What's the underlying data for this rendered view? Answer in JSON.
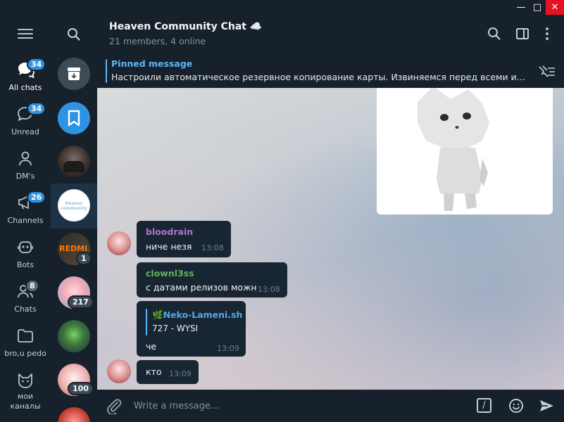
{
  "window": {
    "minimize_glyph": "—",
    "maximize_glyph": "□",
    "close_glyph": "✕"
  },
  "folders": [
    {
      "label": "All chats",
      "badge": "34",
      "icon": "chats-icon"
    },
    {
      "label": "Unread",
      "badge": "34",
      "icon": "chat-bubble-icon"
    },
    {
      "label": "DM's",
      "badge": "",
      "icon": "person-icon"
    },
    {
      "label": "Channels",
      "badge": "26",
      "icon": "channels-icon"
    },
    {
      "label": "Bots",
      "badge": "",
      "icon": "bot-icon"
    },
    {
      "label": "Chats",
      "badge": "8",
      "icon": "group-icon"
    },
    {
      "label": "bro,u pedo",
      "badge": "",
      "icon": "folder-icon"
    },
    {
      "label": "мои каналы",
      "badge": "",
      "icon": "cat-icon"
    }
  ],
  "chat_list": {
    "badges": [
      "1",
      "217",
      "100"
    ],
    "selected_avatar_text": "Heaven community"
  },
  "header": {
    "title": "Heaven Community Chat ☁️",
    "subtitle": "21 members, 4 online"
  },
  "pinned": {
    "title": "Pinned message",
    "text": "Настроили автоматическое резервное копирование карты. Извиняемся перед всеми игрок..."
  },
  "messages": [
    {
      "author": "bloodrain",
      "text": "ниче незя",
      "time": "13:08",
      "author_color": "#b273cc"
    },
    {
      "author": "clownl3ss",
      "text": "с датами релизов можн",
      "time": "13:08",
      "author_color": "#63b35d"
    },
    {
      "reply_name": "🌿Neko-Lameni.sh",
      "reply_text": "727 - WYSI",
      "text": "че",
      "time": "13:09"
    },
    {
      "text": "кто",
      "time": "13:09"
    }
  ],
  "composer": {
    "placeholder": "Write a message...",
    "commands_glyph": "/"
  },
  "colors": {
    "accent": "#5eb5f7",
    "badge": "#2f93e3",
    "sidebar": "#17212b",
    "bubble": "#182533"
  }
}
